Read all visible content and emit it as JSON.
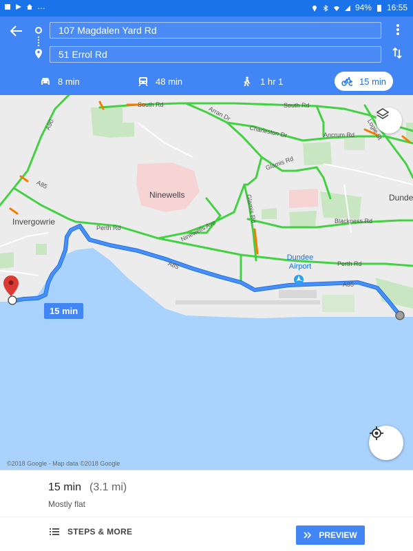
{
  "status_bar": {
    "battery": "94%",
    "time": "16:55"
  },
  "directions": {
    "origin": "107 Magdalen Yard Rd",
    "destination": "51 Errol Rd"
  },
  "modes": [
    {
      "name": "car",
      "label": "8 min"
    },
    {
      "name": "transit",
      "label": "48 min"
    },
    {
      "name": "walk",
      "label": "1 hr 1"
    },
    {
      "name": "bike",
      "label": "15 min",
      "selected": true
    }
  ],
  "map": {
    "labels": {
      "south_rd_1": "South Rd",
      "south_rd_2": "South Rd",
      "arran_dr": "Arran Dr",
      "charleston_dr": "Charleston Dr",
      "ancrum_rd": "Ancrum Rd",
      "logie_st": "Logie St",
      "glamis_rd_1": "Glamis Rd",
      "glamis_rd_2": "Glamis Rd",
      "ninewells": "Ninewells",
      "ninewells_ave": "Ninewells Ave",
      "invergowrie": "Invergowrie",
      "perth_rd_1": "Perth Rd",
      "perth_rd_2": "Perth Rd",
      "blackness_rd": "Blackness Rd",
      "a85_1": "A85",
      "a85_2": "A85",
      "a85_3": "A85",
      "a90": "A90",
      "dundee": "Dunde",
      "dundee_airport": "Dundee Airport"
    },
    "duration_bubble": "15 min",
    "copyright": "©2018 Google - Map data ©2018 Google"
  },
  "summary": {
    "time": "15 min",
    "distance": "(3.1 mi)",
    "terrain": "Mostly flat"
  },
  "actions": {
    "steps": "STEPS & MORE",
    "preview": "PREVIEW"
  },
  "colors": {
    "header": "#4285f4",
    "route": "#4285f4",
    "water": "#a9d3fd",
    "land": "#ececec",
    "park": "#c8e6c1",
    "hospital": "#f6d4d4",
    "traffic_green": "#43d143",
    "traffic_orange": "#f57c00"
  }
}
